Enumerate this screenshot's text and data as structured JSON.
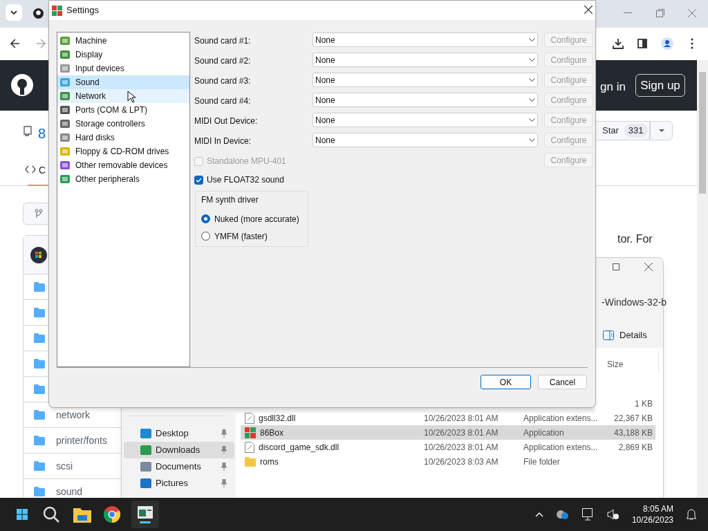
{
  "browser": {
    "github_header": {
      "sign_in": "gn in",
      "sign_up": "Sign up"
    },
    "repo": {
      "name": "8",
      "star_label": "Star",
      "star_count": "331",
      "code_tab": "C"
    },
    "folders": [
      {
        "name": "network"
      },
      {
        "name": "printer/fonts"
      },
      {
        "name": "scsi"
      },
      {
        "name": "sound"
      }
    ],
    "readme_fragment": "tor. For"
  },
  "explorer": {
    "address": "-Windows-32-b",
    "details_button": "Details",
    "size_column": "Size",
    "nav_items": [
      {
        "label": "Desktop",
        "selected": false
      },
      {
        "label": "Downloads",
        "selected": true
      },
      {
        "label": "Documents",
        "selected": false
      },
      {
        "label": "Pictures",
        "selected": false
      }
    ],
    "files": [
      {
        "kind": "partial",
        "size": "1 KB",
        "selected": false
      },
      {
        "kind": "dll",
        "name": "gsdll32.dll",
        "date": "10/26/2023 8:01 AM",
        "type": "Application extens...",
        "size": "22,367 KB",
        "selected": false
      },
      {
        "kind": "app",
        "name": "86Box",
        "date": "10/26/2023 8:01 AM",
        "type": "Application",
        "size": "43,188 KB",
        "selected": true
      },
      {
        "kind": "dll",
        "name": "discord_game_sdk.dll",
        "date": "10/26/2023 8:01 AM",
        "type": "Application extens...",
        "size": "2,869 KB",
        "selected": false
      },
      {
        "kind": "folder",
        "name": "roms",
        "date": "10/26/2023 8:03 AM",
        "type": "File folder",
        "selected": false
      }
    ]
  },
  "dialog": {
    "title": "Settings",
    "categories": [
      {
        "label": "Machine",
        "selected": false,
        "hovered": false
      },
      {
        "label": "Display",
        "selected": false,
        "hovered": false
      },
      {
        "label": "Input devices",
        "selected": false,
        "hovered": false
      },
      {
        "label": "Sound",
        "selected": true,
        "hovered": false
      },
      {
        "label": "Network",
        "selected": false,
        "hovered": true
      },
      {
        "label": "Ports (COM & LPT)",
        "selected": false,
        "hovered": false
      },
      {
        "label": "Storage controllers",
        "selected": false,
        "hovered": false
      },
      {
        "label": "Hard disks",
        "selected": false,
        "hovered": false
      },
      {
        "label": "Floppy & CD-ROM drives",
        "selected": false,
        "hovered": false
      },
      {
        "label": "Other removable devices",
        "selected": false,
        "hovered": false
      },
      {
        "label": "Other peripherals",
        "selected": false,
        "hovered": false
      }
    ],
    "devices": [
      {
        "label": "Sound card #1:",
        "value": "None",
        "configure": "Configure",
        "configure_disabled": true
      },
      {
        "label": "Sound card #2:",
        "value": "None",
        "configure": "Configure",
        "configure_disabled": true
      },
      {
        "label": "Sound card #3:",
        "value": "None",
        "configure": "Configure",
        "configure_disabled": true
      },
      {
        "label": "Sound card #4:",
        "value": "None",
        "configure": "Configure",
        "configure_disabled": true
      },
      {
        "label": "MIDI Out Device:",
        "value": "None",
        "configure": "Configure",
        "configure_disabled": true
      },
      {
        "label": "MIDI In Device:",
        "value": "None",
        "configure": "Configure",
        "configure_disabled": true
      }
    ],
    "mpu": {
      "label": "Standalone MPU-401",
      "checked": false,
      "disabled": true,
      "configure": "Configure",
      "configure_disabled": true
    },
    "float32": {
      "label": "Use FLOAT32 sound",
      "checked": true
    },
    "fm_group": {
      "title": "FM synth driver",
      "options": [
        {
          "label": "Nuked (more accurate)",
          "selected": true
        },
        {
          "label": "YMFM (faster)",
          "selected": false
        }
      ]
    },
    "ok": "OK",
    "cancel": "Cancel"
  },
  "taskbar": {
    "time": "8:05 AM",
    "date": "10/26/2023"
  }
}
